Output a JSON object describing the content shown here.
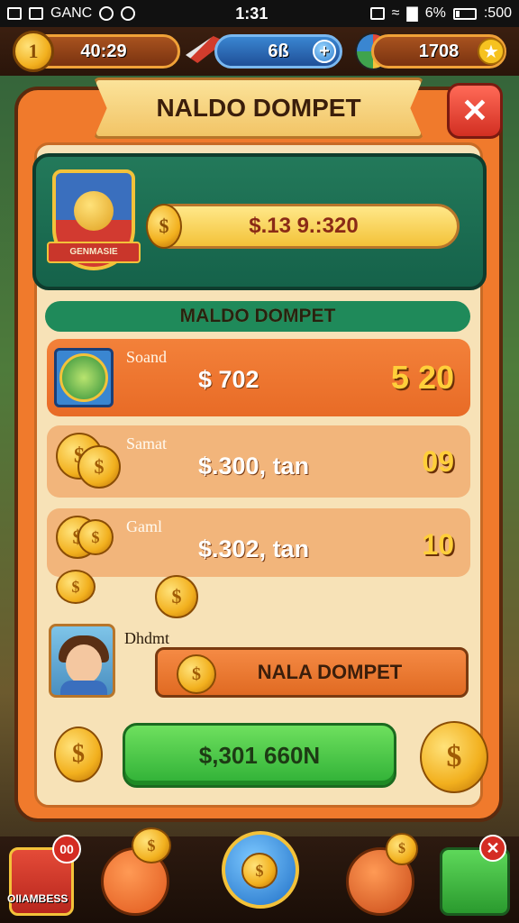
{
  "status_bar": {
    "app_label": "GANC",
    "time": "1:31",
    "battery_percent": "6%",
    "right_label": ":500"
  },
  "resources": {
    "coins": "40:29",
    "gems": "6ß",
    "stars": "1708",
    "coin_symbol": "1",
    "plus_symbol": "+",
    "star_symbol": "★"
  },
  "panel": {
    "title": "NALDO DOMPET",
    "close_symbol": "✕"
  },
  "hero": {
    "shield_text": "GENMASIE",
    "coin_symbol": "$",
    "balance": "$.13 9.:320"
  },
  "section_title": "MALDO DOMPET",
  "rows": [
    {
      "label": "Soand",
      "amount": "$ 702",
      "value": "5 20"
    },
    {
      "label": "Samat",
      "amount": "$.300, tan",
      "value": "09"
    },
    {
      "label": "Gaml",
      "amount": "$.302, tan",
      "value": "10"
    }
  ],
  "player": {
    "label": "Dhdmt",
    "action_button": "NALA DOMPET",
    "coin_symbol": "$"
  },
  "confirm_button": "$,301 660N",
  "nav": {
    "cards_label": "OIIAMBESS",
    "cards_badge": "00",
    "close_badge": "✕"
  },
  "colors": {
    "panel_orange": "#f07a2c",
    "hero_green": "#1f7a57",
    "confirm_green": "#3fc445",
    "gold": "#f3c23a"
  }
}
